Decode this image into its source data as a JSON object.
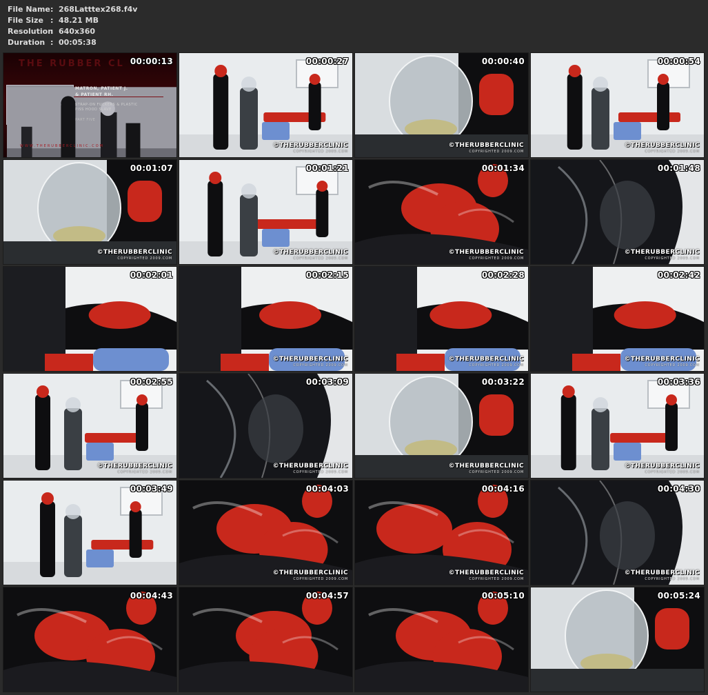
{
  "file_info": {
    "separator": ":",
    "rows": [
      {
        "label": "File Name",
        "value": "268Latttex268.f4v"
      },
      {
        "label": "File Size",
        "value": "48.21 MB"
      },
      {
        "label": "Resolution",
        "value": "640x360"
      },
      {
        "label": "Duration",
        "value": "00:05:38"
      }
    ]
  },
  "title_card": {
    "title": "THE RUBBER CL",
    "line1": "MATRON, PATIENT J.",
    "line2": "& PATIENT RH.",
    "line3": "STRAP-ON FUCKERS & PLASTIC",
    "line4": "PISS HOOD SLAVE",
    "line5": "PART FIVE",
    "url": "WWW.THERUBBERCLINIC.COM"
  },
  "watermark": {
    "main": "©THERUBBERCLINIC",
    "sub": "COPYRIGHTED 2009.COM"
  },
  "thumbnails": [
    {
      "timestamp": "00:00:13",
      "scene": "title",
      "watermark": false
    },
    {
      "timestamp": "00:00:27",
      "scene": "clinic-wide",
      "watermark": true
    },
    {
      "timestamp": "00:00:40",
      "scene": "hood-closeup",
      "watermark": true
    },
    {
      "timestamp": "00:00:54",
      "scene": "clinic-wide",
      "watermark": true
    },
    {
      "timestamp": "00:01:07",
      "scene": "hood-closeup",
      "watermark": true
    },
    {
      "timestamp": "00:01:21",
      "scene": "clinic-wide",
      "watermark": true
    },
    {
      "timestamp": "00:01:34",
      "scene": "latex-closeup",
      "watermark": true
    },
    {
      "timestamp": "00:01:48",
      "scene": "dark-closeup",
      "watermark": true
    },
    {
      "timestamp": "00:02:01",
      "scene": "chair-closeup",
      "watermark": false
    },
    {
      "timestamp": "00:02:15",
      "scene": "chair-closeup",
      "watermark": true
    },
    {
      "timestamp": "00:02:28",
      "scene": "chair-closeup",
      "watermark": true
    },
    {
      "timestamp": "00:02:42",
      "scene": "chair-closeup",
      "watermark": true
    },
    {
      "timestamp": "00:02:55",
      "scene": "clinic-wide",
      "watermark": true
    },
    {
      "timestamp": "00:03:09",
      "scene": "dark-closeup",
      "watermark": true
    },
    {
      "timestamp": "00:03:22",
      "scene": "hood-closeup",
      "watermark": true
    },
    {
      "timestamp": "00:03:36",
      "scene": "clinic-wide",
      "watermark": true
    },
    {
      "timestamp": "00:03:49",
      "scene": "clinic-wide",
      "watermark": false
    },
    {
      "timestamp": "00:04:03",
      "scene": "latex-closeup",
      "watermark": true
    },
    {
      "timestamp": "00:04:16",
      "scene": "latex-closeup",
      "watermark": true
    },
    {
      "timestamp": "00:04:30",
      "scene": "dark-closeup",
      "watermark": true
    },
    {
      "timestamp": "00:04:43",
      "scene": "latex-closeup",
      "watermark": false
    },
    {
      "timestamp": "00:04:57",
      "scene": "latex-closeup",
      "watermark": false
    },
    {
      "timestamp": "00:05:10",
      "scene": "latex-closeup",
      "watermark": false
    },
    {
      "timestamp": "00:05:24",
      "scene": "hood-closeup",
      "watermark": false
    }
  ],
  "colors": {
    "background": "#2b2b2b",
    "info_text": "#dcdcdc",
    "latex_red": "#c8281c",
    "latex_black": "#0e0e10",
    "clinic_wall": "#e9ecee",
    "chair_blue": "#6d8fd0"
  }
}
